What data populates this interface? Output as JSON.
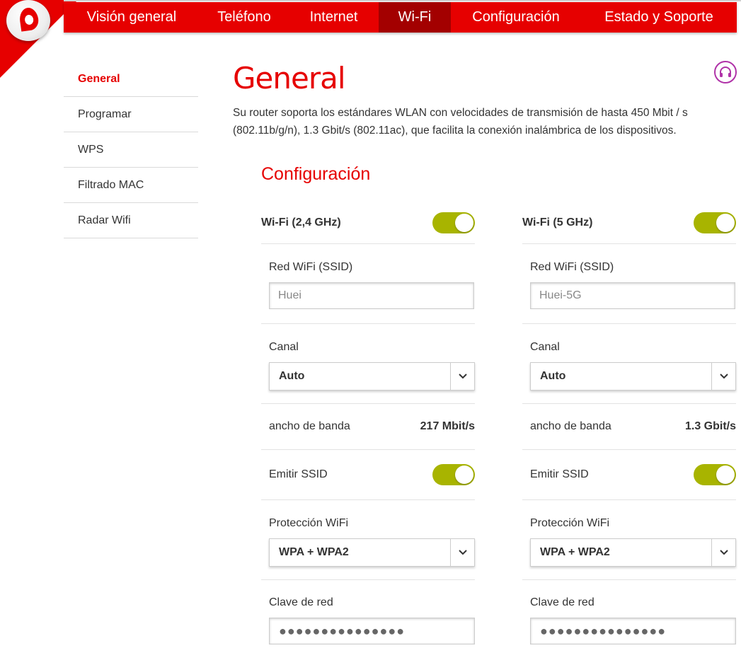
{
  "nav": {
    "items": [
      {
        "label": "Visión general"
      },
      {
        "label": "Teléfono"
      },
      {
        "label": "Internet"
      },
      {
        "label": "Wi-Fi"
      },
      {
        "label": "Configuración"
      },
      {
        "label": "Estado y Soporte"
      }
    ],
    "active": "Wi-Fi"
  },
  "sidebar": {
    "items": [
      {
        "label": "General"
      },
      {
        "label": "Programar"
      },
      {
        "label": "WPS"
      },
      {
        "label": "Filtrado MAC"
      },
      {
        "label": "Radar Wifi"
      }
    ],
    "active": "General"
  },
  "page": {
    "title": "General",
    "description": "Su router soporta los estándares WLAN con velocidades de transmisión de hasta 450 Mbit / s (802.11b/g/n), 1.3 Gbit/s (802.11ac), que facilita la conexión inalámbrica de los dispositivos.",
    "section_title": "Configuración",
    "help_icon": "help-icon"
  },
  "bands": [
    {
      "label": "Wi-Fi (2,4 GHz)",
      "enabled": true,
      "ssid_label": "Red WiFi (SSID)",
      "ssid_placeholder": "Huei",
      "channel_label": "Canal",
      "channel_value": "Auto",
      "bandwidth_label": "ancho de banda",
      "bandwidth_value": "217 Mbit/s",
      "broadcast_label": "Emitir SSID",
      "broadcast_enabled": true,
      "protection_label": "Protección WiFi",
      "protection_value": "WPA + WPA2",
      "password_label": "Clave de red",
      "password_masked": "●●●●●●●●●●●●●●●"
    },
    {
      "label": "Wi-Fi (5 GHz)",
      "enabled": true,
      "ssid_label": "Red WiFi (SSID)",
      "ssid_placeholder": "Huei-5G",
      "channel_label": "Canal",
      "channel_value": "Auto",
      "bandwidth_label": "ancho de banda",
      "bandwidth_value": "1.3 Gbit/s",
      "broadcast_label": "Emitir SSID",
      "broadcast_enabled": true,
      "protection_label": "Protección WiFi",
      "protection_value": "WPA + WPA2",
      "password_label": "Clave de red",
      "password_masked": "●●●●●●●●●●●●●●●"
    }
  ],
  "colors": {
    "brand_red": "#e60000",
    "active_nav": "#a30000",
    "toggle_on": "#a8b400",
    "help_purple": "#b033a8"
  }
}
